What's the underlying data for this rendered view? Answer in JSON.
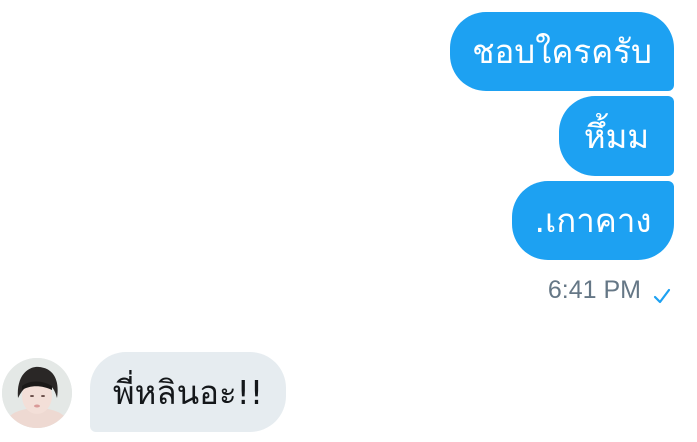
{
  "conversation": {
    "outgoing": [
      {
        "text": "ชอบใครครับ"
      },
      {
        "text": "หึ้มม"
      },
      {
        "text": ".เกาคาง"
      }
    ],
    "outgoing_status": {
      "time": "6:41 PM",
      "read_icon": "checkmark-icon"
    },
    "incoming": [
      {
        "text": "พี่หลินอะ!!"
      }
    ],
    "colors": {
      "outgoing_bubble": "#1da1f2",
      "incoming_bubble": "#e6ecf0",
      "meta_text": "#657786",
      "check_accent": "#1da1f2"
    }
  }
}
